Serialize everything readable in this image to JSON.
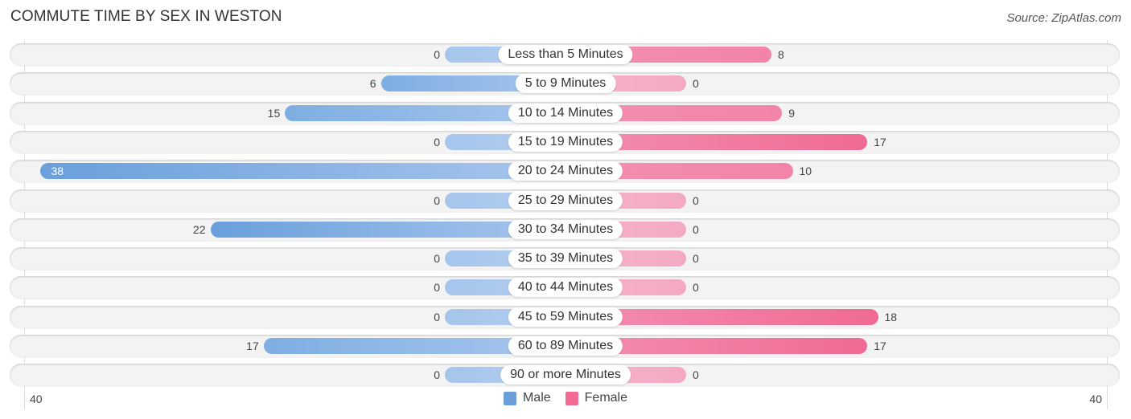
{
  "title": "COMMUTE TIME BY SEX IN WESTON",
  "source": "Source: ZipAtlas.com",
  "colors": {
    "male": "#6a9fdc",
    "female": "#f06a93",
    "male_light": "#aac8ee",
    "female_light": "#f5a8c3"
  },
  "chart_data": {
    "type": "bar",
    "orientation": "horizontal-diverging",
    "title": "COMMUTE TIME BY SEX IN WESTON",
    "categories": [
      "Less than 5 Minutes",
      "5 to 9 Minutes",
      "10 to 14 Minutes",
      "15 to 19 Minutes",
      "20 to 24 Minutes",
      "25 to 29 Minutes",
      "30 to 34 Minutes",
      "35 to 39 Minutes",
      "40 to 44 Minutes",
      "45 to 59 Minutes",
      "60 to 89 Minutes",
      "90 or more Minutes"
    ],
    "series": [
      {
        "name": "Male",
        "values": [
          0,
          6,
          15,
          0,
          38,
          0,
          22,
          0,
          0,
          0,
          17,
          0
        ]
      },
      {
        "name": "Female",
        "values": [
          8,
          0,
          9,
          17,
          10,
          0,
          0,
          0,
          0,
          18,
          17,
          0
        ]
      }
    ],
    "axis": {
      "left_label": "40",
      "right_label": "40",
      "range": [
        40,
        40
      ]
    },
    "legend": {
      "position": "bottom-center",
      "entries": [
        "Male",
        "Female"
      ]
    },
    "grid": false
  }
}
